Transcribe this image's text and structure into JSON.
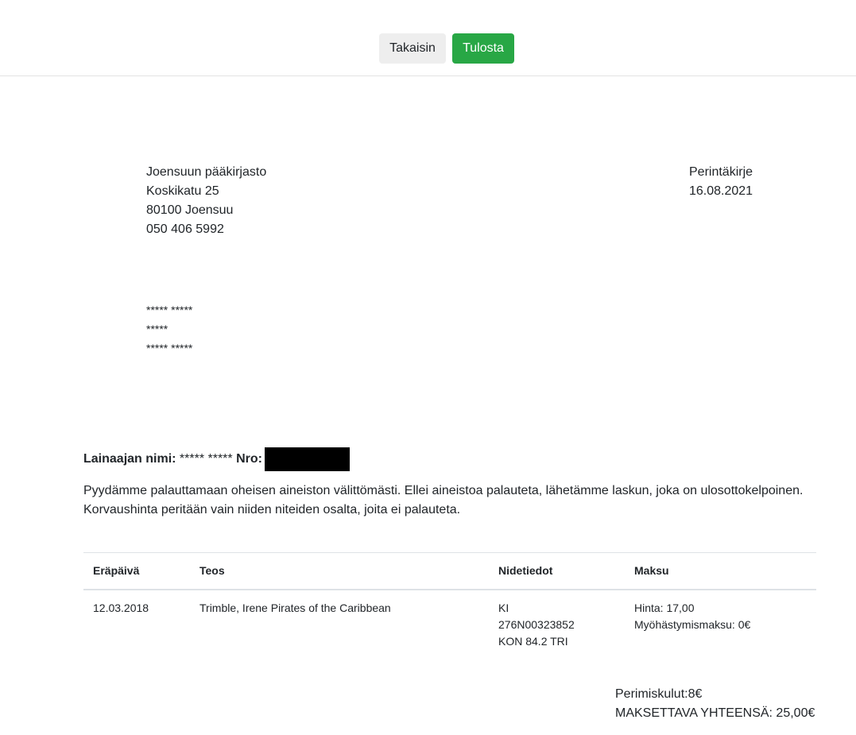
{
  "toolbar": {
    "back_label": "Takaisin",
    "print_label": "Tulosta",
    "print_color": "#28a745"
  },
  "sender": {
    "name": "Joensuun pääkirjasto",
    "street": "Koskikatu 25",
    "postal": "80100 Joensuu",
    "phone": "050 406 5992"
  },
  "letter": {
    "type": "Perintäkirje",
    "date": "16.08.2021"
  },
  "recipient": {
    "name": "***** *****",
    "street": "*****",
    "postal": "***** *****"
  },
  "borrower": {
    "name_label": "Lainaajan nimi:",
    "name_value": " ***** ***** ",
    "number_label": "Nro:"
  },
  "notice": {
    "line1": "Pyydämme palauttamaan oheisen aineiston välittömästi. Ellei aineistoa palauteta, lähetämme laskun, joka on ulosottokelpoinen.",
    "line2": "Korvaushinta peritään vain niiden niteiden osalta, joita ei palauteta."
  },
  "table": {
    "headers": [
      "Eräpäivä",
      "Teos",
      "Nidetiedot",
      "Maksu"
    ],
    "rows": [
      {
        "due_date": "12.03.2018",
        "work": "Trimble, Irene Pirates of the Caribbean",
        "copy_line1": "KI",
        "copy_line2": "276N00323852",
        "copy_line3": "KON 84.2 TRI",
        "price": "Hinta: 17,00",
        "late_fee": "Myöhästymismaksu: 0€"
      }
    ]
  },
  "totals": {
    "collection_fee": "Perimiskulut:8€",
    "grand_total": "MAKSETTAVA YHTEENSÄ: 25,00€"
  }
}
